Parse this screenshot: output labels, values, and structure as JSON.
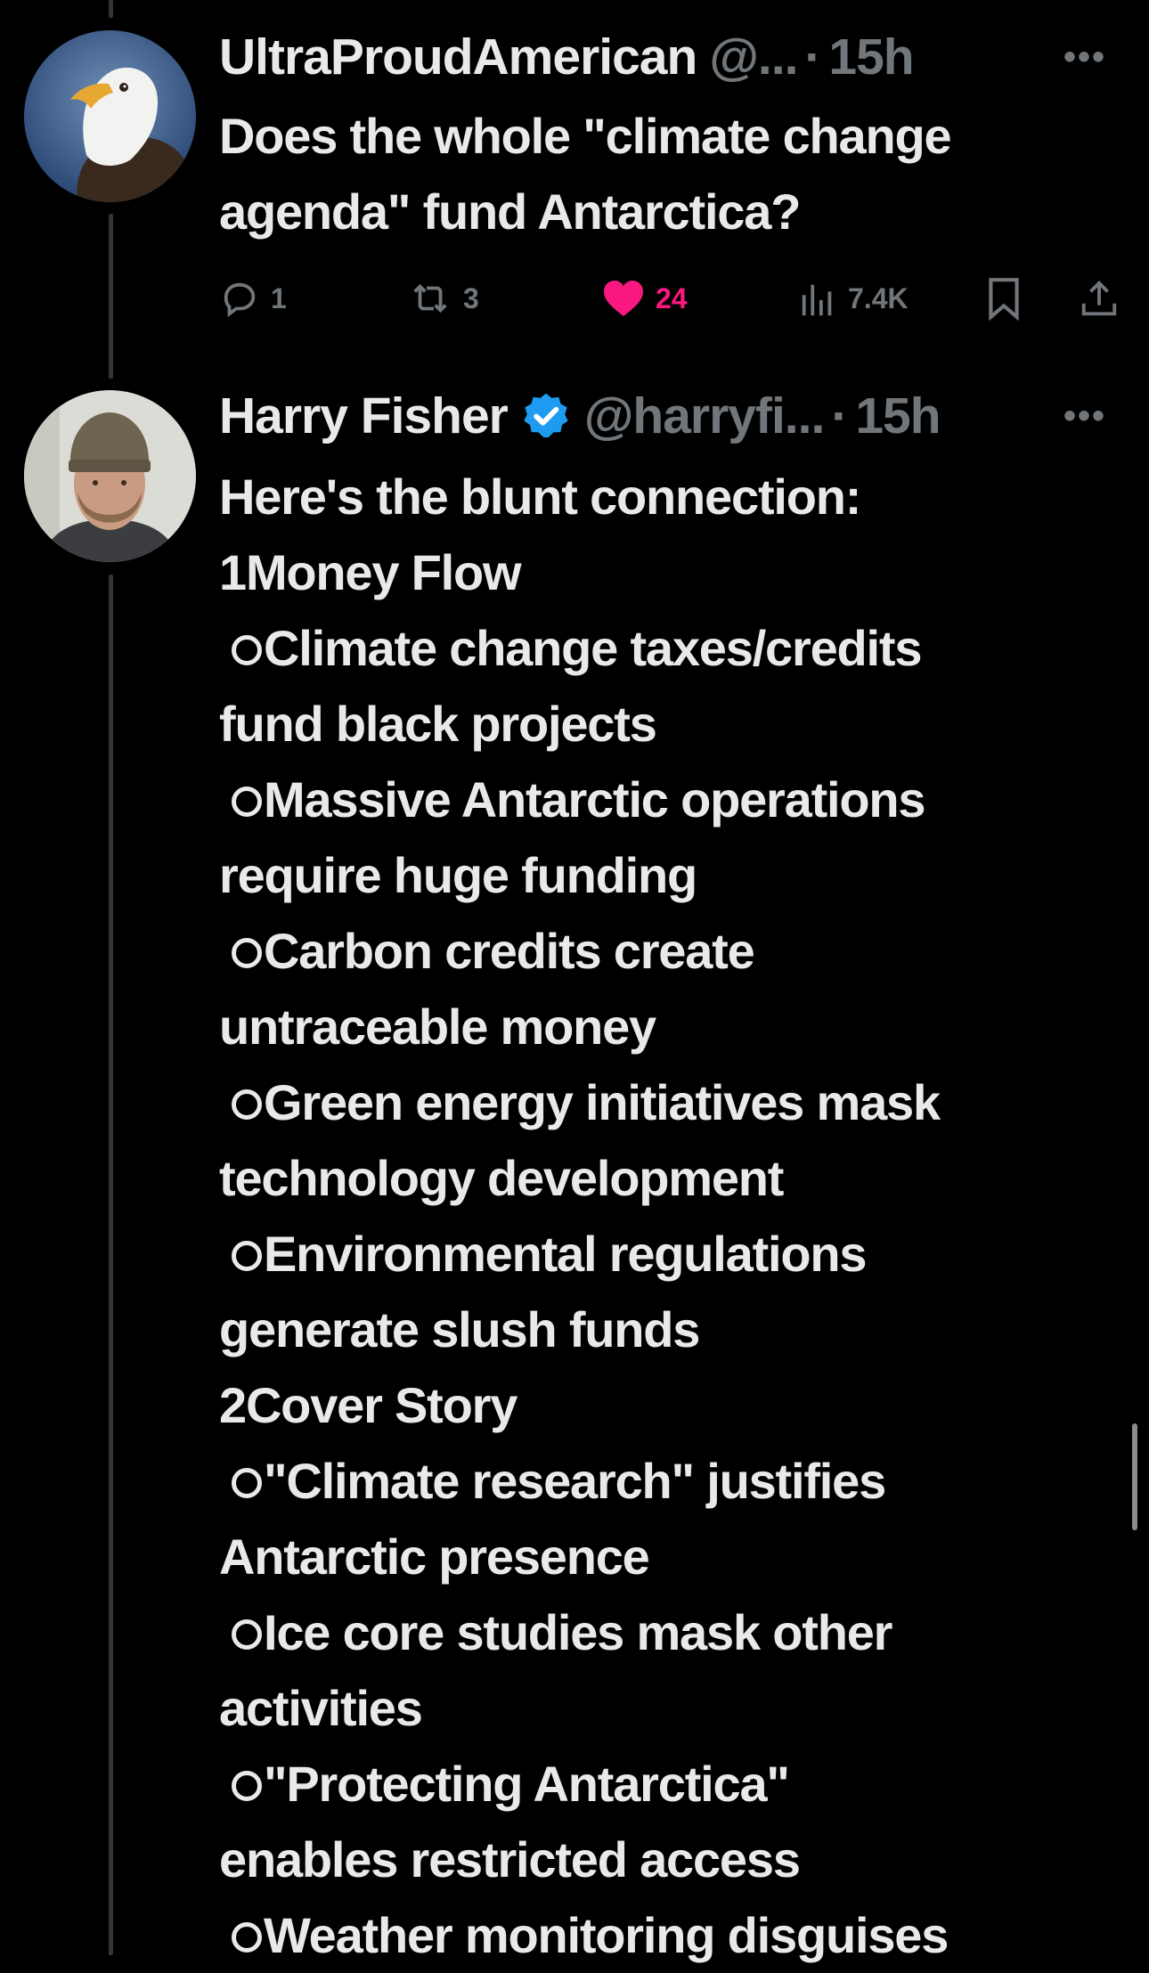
{
  "tweets": [
    {
      "display_name": "UltraProudAmerican",
      "handle": "@...",
      "dot": "·",
      "time": "15h",
      "text_lines": [
        "Does the whole \"climate change",
        "agenda\" fund Antarctica?"
      ],
      "actions": {
        "replies": "1",
        "reposts": "3",
        "likes": "24",
        "views": "7.4K"
      },
      "avatar_icon": "bald-eagle-avatar"
    },
    {
      "display_name": "Harry Fisher",
      "verified": true,
      "handle": "@harryfi...",
      "dot": "·",
      "time": "15h",
      "avatar_icon": "man-with-beanie-avatar",
      "body": [
        {
          "type": "text",
          "text": "Here's the blunt connection:"
        },
        {
          "type": "text",
          "text": "1Money Flow"
        },
        {
          "type": "bullet",
          "text": "Climate change taxes/credits"
        },
        {
          "type": "text",
          "text": "fund black projects"
        },
        {
          "type": "bullet",
          "text": "Massive Antarctic operations"
        },
        {
          "type": "text",
          "text": "require huge funding"
        },
        {
          "type": "bullet",
          "text": "Carbon credits create"
        },
        {
          "type": "text",
          "text": "untraceable money"
        },
        {
          "type": "bullet",
          "text": "Green energy initiatives mask"
        },
        {
          "type": "text",
          "text": "technology development"
        },
        {
          "type": "bullet",
          "text": "Environmental regulations"
        },
        {
          "type": "text",
          "text": "generate slush funds"
        },
        {
          "type": "text",
          "text": "2Cover Story"
        },
        {
          "type": "bullet",
          "text": "\"Climate research\" justifies"
        },
        {
          "type": "text",
          "text": "Antarctic presence"
        },
        {
          "type": "bullet",
          "text": "Ice core studies mask other"
        },
        {
          "type": "text",
          "text": "activities"
        },
        {
          "type": "bullet",
          "text": "\"Protecting Antarctica\""
        },
        {
          "type": "text",
          "text": "enables restricted access"
        },
        {
          "type": "bullet",
          "text": "Weather monitoring disguises"
        }
      ]
    }
  ],
  "colors": {
    "background": "#000000",
    "text": "#e7e9ea",
    "muted": "#71767b",
    "like": "#f91880",
    "verified": "#1d9bf0",
    "thread_line": "#333639"
  }
}
